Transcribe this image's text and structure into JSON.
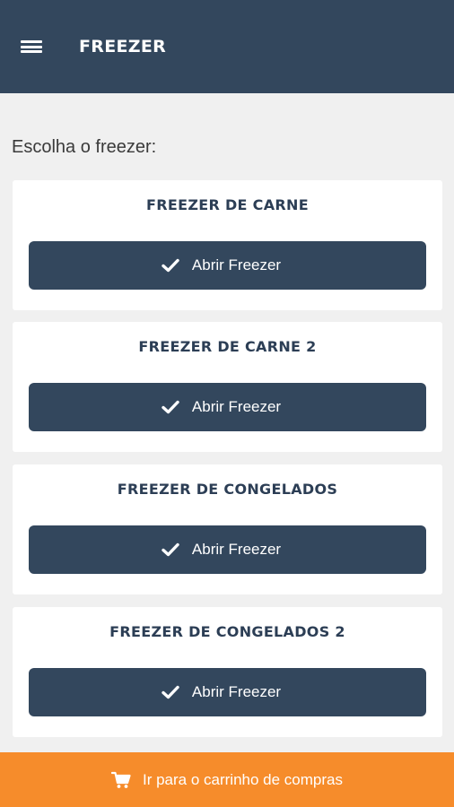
{
  "appbar": {
    "title": "FREEZER",
    "menu_icon": "hamburger-menu-icon"
  },
  "prompt": "Escolha o freezer:",
  "freezers": [
    {
      "name": "FREEZER DE CARNE",
      "button_label": "Abrir Freezer"
    },
    {
      "name": "FREEZER DE CARNE 2",
      "button_label": "Abrir Freezer"
    },
    {
      "name": "FREEZER DE CONGELADOS",
      "button_label": "Abrir Freezer"
    },
    {
      "name": "FREEZER DE CONGELADOS 2",
      "button_label": "Abrir Freezer"
    }
  ],
  "cart": {
    "label": "Ir para o carrinho de compras",
    "icon": "shopping-cart-icon"
  },
  "colors": {
    "primary": "#33475d",
    "accent": "#f68c2b",
    "background": "#f0f0f0"
  }
}
